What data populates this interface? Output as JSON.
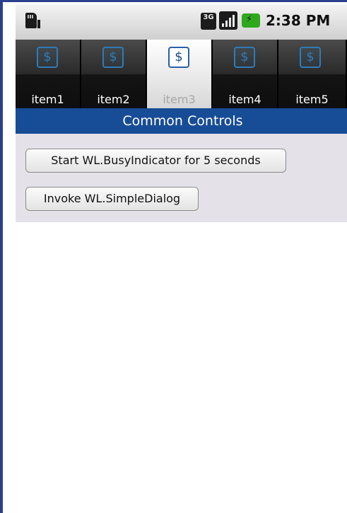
{
  "status_bar": {
    "network_label": "3G",
    "time": "2:38 PM",
    "icons": [
      "sd-card-icon",
      "network-3g-icon",
      "signal-icon",
      "battery-charging-icon"
    ]
  },
  "tabs": [
    {
      "label": "item1",
      "icon": "dollar-icon",
      "selected": false
    },
    {
      "label": "item2",
      "icon": "dollar-icon",
      "selected": false
    },
    {
      "label": "item3",
      "icon": "dollar-icon",
      "selected": true
    },
    {
      "label": "item4",
      "icon": "dollar-icon",
      "selected": false
    },
    {
      "label": "item5",
      "icon": "dollar-icon",
      "selected": false
    }
  ],
  "tab_icon_glyph": "$",
  "header": {
    "title": "Common Controls"
  },
  "buttons": {
    "busy_indicator": "Start WL.BusyIndicator for 5 seconds",
    "simple_dialog": "Invoke WL.SimpleDialog"
  },
  "colors": {
    "frame_border": "#2b3f8f",
    "header_bg": "#174c96",
    "content_bg": "#e4e2e8",
    "tab_icon": "#2f7bb8",
    "battery": "#2fa81e"
  }
}
